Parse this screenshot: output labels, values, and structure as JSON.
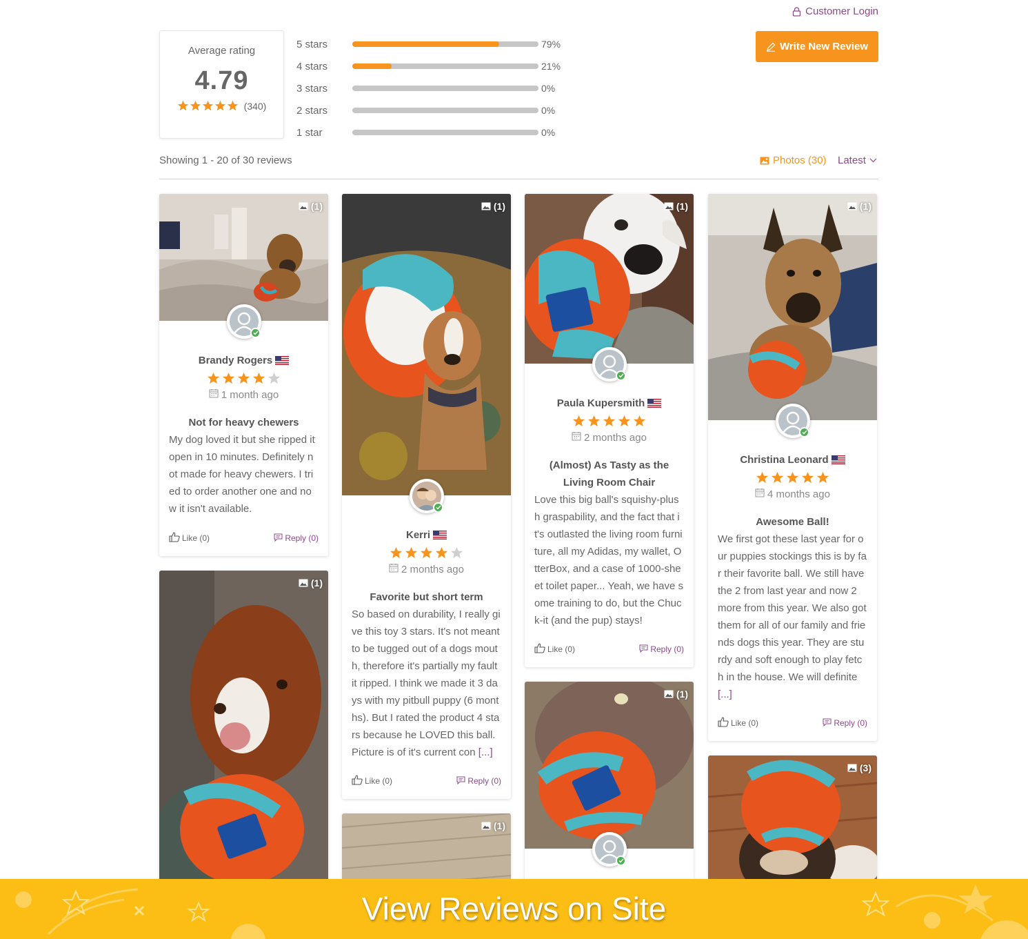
{
  "header": {
    "customer_login": "Customer Login",
    "write_review": "Write New Review"
  },
  "summary": {
    "average_label": "Average rating",
    "average_value": "4.79",
    "total_count": "(340)",
    "distribution": [
      {
        "label": "5 stars",
        "percent_text": "79%",
        "fraction": 0.79
      },
      {
        "label": "4 stars",
        "percent_text": "21%",
        "fraction": 0.21
      },
      {
        "label": "3 stars",
        "percent_text": "0%",
        "fraction": 0
      },
      {
        "label": "2 stars",
        "percent_text": "0%",
        "fraction": 0
      },
      {
        "label": "1 star",
        "percent_text": "0%",
        "fraction": 0
      }
    ]
  },
  "toolbar": {
    "showing": "Showing 1 - 20 of 30 reviews",
    "photos_filter": "Photos (30)",
    "sort": "Latest"
  },
  "colors": {
    "accent": "#f7941d",
    "link": "#8a4a8a",
    "banner": "#fcbe14"
  },
  "reviews": [
    {
      "name": "Brandy Rogers",
      "rating": 4,
      "date": "1 month ago",
      "title": "Not for heavy chewers",
      "text": "My dog loved it but she ripped it open in 10 minutes. Definitely not made for heavy chewers. I tried to order another one and now it isn't available.",
      "more": "",
      "photo_count": "(1)",
      "like": "Like (0)",
      "reply": "Reply (0)"
    },
    {
      "name": "Kerri",
      "rating": 4,
      "date": "2 months ago",
      "title": "Favorite but short term",
      "text": "So based on durability, I really give this toy 3 stars. It's not meant to be tugged out of a dogs mouth, therefore it's partially my fault it ripped. I think we made it 3 days with my pitbull puppy (6 months). But I rated the product 4 stars because he LOVED this ball. Picture is of it's current con",
      "more": "[...]",
      "photo_count": "(1)",
      "like": "Like (0)",
      "reply": "Reply (0)"
    },
    {
      "name": "Paula Kupersmith",
      "rating": 5,
      "date": "2 months ago",
      "title": "(Almost) As Tasty as the Living Room Chair",
      "text": "Love this big ball's squishy-plush graspability, and the fact that it's outlasted the living room furniture, all my Adidas, my wallet, OtterBox, and a case of 1000-sheet toilet paper... Yeah, we have some training to do, but the Chuck-it (and the pup) stays!",
      "more": "",
      "photo_count": "(1)",
      "like": "Like (0)",
      "reply": "Reply (0)"
    },
    {
      "name": "Christina Leonard",
      "rating": 5,
      "date": "4 months ago",
      "title": "Awesome Ball!",
      "text": "We first got these last year for our puppies stockings this is by far their favorite ball. We still have the 2 from last year and now 2 more from this year. We also got them for all of our family and friends dogs this year. They are sturdy and soft enough to play fetch in the house. We will definite",
      "more": "[...]",
      "photo_count": "(1)",
      "like": "Like (0)",
      "reply": "Reply (0)"
    }
  ],
  "partial_cards": [
    {
      "photo_count": "(1)"
    },
    {
      "photo_count": "(1)"
    },
    {
      "photo_count": "(1)"
    },
    {
      "photo_count": "(3)"
    }
  ],
  "banner": {
    "text": "View Reviews on Site"
  }
}
